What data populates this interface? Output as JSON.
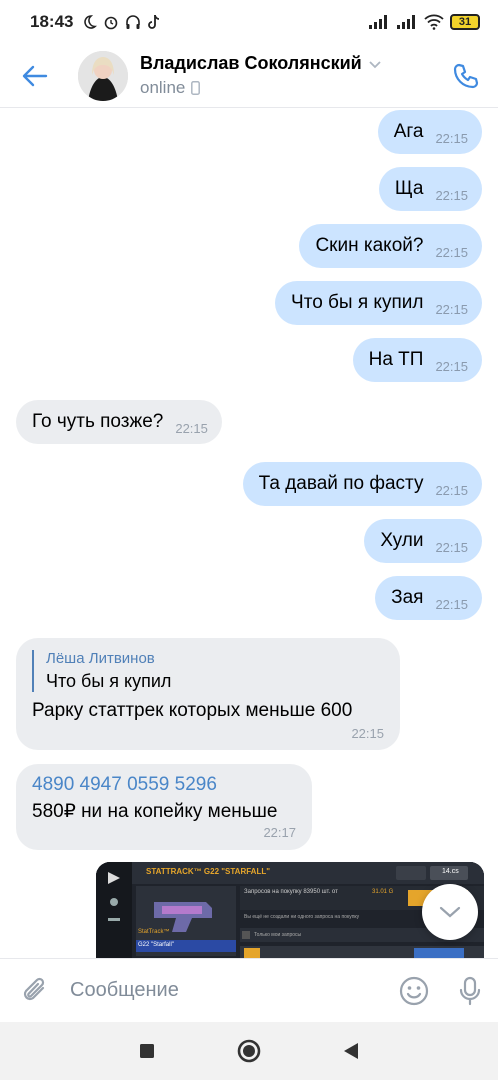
{
  "status_bar": {
    "time": "18:43",
    "battery": "31"
  },
  "header": {
    "name": "Владислав Соколянский",
    "status": "online"
  },
  "messages": [
    {
      "dir": "out",
      "text": "Ага",
      "time": "22:15"
    },
    {
      "dir": "out",
      "text": "Ща",
      "time": "22:15"
    },
    {
      "dir": "out",
      "text": "Скин какой?",
      "time": "22:15"
    },
    {
      "dir": "out",
      "text": "Что бы я купил",
      "time": "22:15"
    },
    {
      "dir": "out",
      "text": "На ТП",
      "time": "22:15"
    },
    {
      "dir": "in",
      "text": "Го чуть позже?",
      "time": "22:15"
    },
    {
      "dir": "out",
      "text": "Та давай по фасту",
      "time": "22:15"
    },
    {
      "dir": "out",
      "text": "Хули",
      "time": "22:15"
    },
    {
      "dir": "out",
      "text": "Зая",
      "time": "22:15"
    }
  ],
  "reply_message": {
    "quote_author": "Лёша Литвинов",
    "quote_text": "Что бы я купил",
    "text": "Рарку статтрек которых меньше 600",
    "time": "22:15"
  },
  "card_message": {
    "card_number": "4890 4947 0559 5296",
    "text": "580₽ ни на копейку меньше",
    "time": "22:17"
  },
  "image_message": {
    "weapon_label": "STATTRACK™ G22 \"STARFALL\"",
    "balance": "14.cs",
    "item_title": "StatTrack™",
    "item_name": "G22 \"Starfall\"",
    "request_text": "Запросов на покупку 83950 шт. от",
    "request_price": "31.01 G",
    "empty_text": "Вы ещё не создали ни одного запроса на покупку",
    "only_my": "Только мои запросы"
  },
  "composer": {
    "placeholder": "Сообщение"
  },
  "colors": {
    "outgoing": "#cce4ff",
    "incoming": "#ebedf0",
    "accent": "#5181b8"
  }
}
